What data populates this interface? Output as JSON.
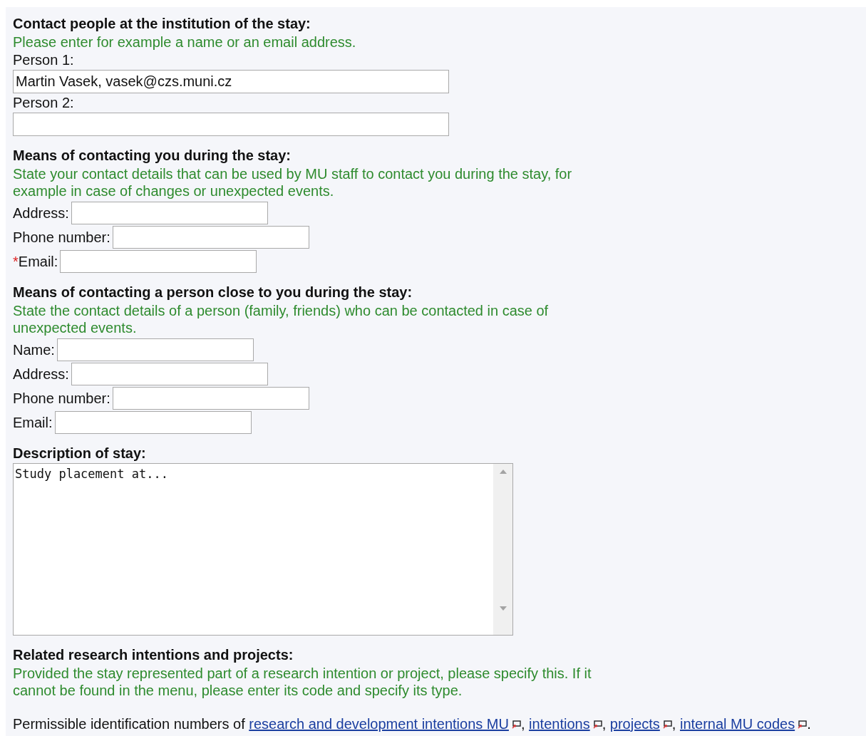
{
  "sections": [
    {
      "kind": "stacked",
      "heading": "Contact people at the institution of the stay:",
      "hint": "Please enter for example a name or an email address.",
      "fields": [
        {
          "label": "Person 1:",
          "value": "Martin Vasek, vasek@czs.muni.cz"
        },
        {
          "label": "Person 2:"
        }
      ]
    },
    {
      "kind": "inline",
      "heading": "Means of contacting you during the stay:",
      "hint": "State your contact details that can be used by MU staff to contact you during the stay, for example in case of changes or unexpected events.",
      "fields": [
        {
          "label": "Address:"
        },
        {
          "label": "Phone number:"
        },
        {
          "label": "Email:",
          "required_mark": "*"
        }
      ]
    },
    {
      "kind": "inline",
      "heading": "Means of contacting a person close to you during the stay:",
      "hint": "State the contact details of a person (family, friends) who can be contacted in case of unexpected events.",
      "fields": [
        {
          "label": "Name:"
        },
        {
          "label": "Address:"
        },
        {
          "label": "Phone number:"
        },
        {
          "label": "Email:"
        }
      ]
    },
    {
      "kind": "textarea",
      "heading": "Description of stay:",
      "value": "Study placement at..."
    },
    {
      "kind": "links",
      "heading": "Related research intentions and projects:",
      "hint": "Provided the stay represented part of a research intention or project, please specify this. If it cannot be found in the menu, please enter its code and specify its type.",
      "prefix": "Permissible identification numbers of",
      "links": [
        {
          "text": "research and development intentions MU",
          "after": ","
        },
        {
          "text": "intentions",
          "after": ","
        },
        {
          "text": "projects",
          "after": ","
        },
        {
          "text": "internal MU codes",
          "after": "."
        }
      ]
    }
  ]
}
